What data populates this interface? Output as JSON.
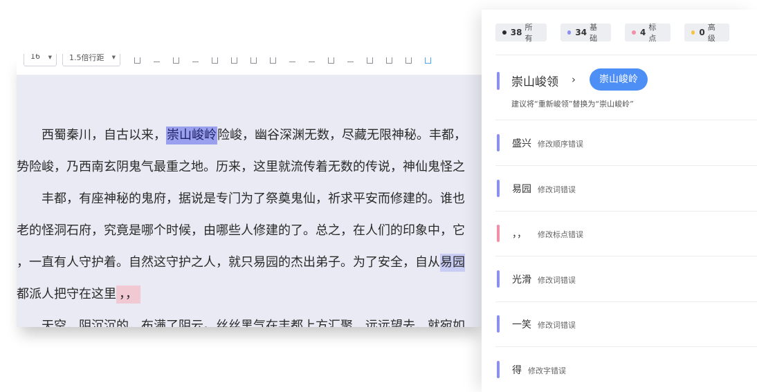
{
  "toolbar": {
    "font_size": "16",
    "line_spacing": "1.5倍行距"
  },
  "document": {
    "lines": [
      {
        "indent": true,
        "parts": [
          {
            "t": "西蜀秦川，自古以来，"
          },
          {
            "t": "崇山峻岭",
            "h": "blue"
          },
          {
            "t": "险峻，幽谷深渊无数，尽藏无限神秘。丰都，"
          }
        ]
      },
      {
        "indent": false,
        "parts": [
          {
            "t": "势险峻，乃西南玄阴鬼气最重之地。历来，这里就流传着无数的传说，神仙鬼怪之"
          }
        ]
      },
      {
        "indent": true,
        "parts": [
          {
            "t": "丰都，有座神秘的鬼府，据说是专门为了祭奠鬼仙，祈求平安而修建的。谁也"
          }
        ]
      },
      {
        "indent": false,
        "parts": [
          {
            "t": "老的怪洞石府，究竟是哪个时候，由哪些人修建的了。总之，在人们的印象中，它"
          }
        ]
      },
      {
        "indent": false,
        "parts": [
          {
            "t": "，一直有人守护着。自然这守护之人，就只易园的杰出弟子。为了安全，自从"
          },
          {
            "t": "易园",
            "h": "light"
          }
        ]
      },
      {
        "indent": false,
        "parts": [
          {
            "t": "都派人把守在这里"
          },
          {
            "t": "，，",
            "h": "pink"
          }
        ]
      },
      {
        "indent": true,
        "parts": [
          {
            "t": "天空，阴沉沉的，布满了阴云。丝丝黑气在丰都上方汇聚，远远望去，就宛如"
          }
        ]
      }
    ]
  },
  "panel": {
    "filters": [
      {
        "count": "38",
        "label": "所有",
        "color": "#2b2b2b"
      },
      {
        "count": "34",
        "label": "基础",
        "color": "#8b8ff0"
      },
      {
        "count": "4",
        "label": "标点",
        "color": "#f28fa6"
      },
      {
        "count": "0",
        "label": "高级",
        "color": "#f5c542"
      }
    ],
    "featured": {
      "original": "崇山峻领",
      "arrow": "›",
      "suggestion": "崇山峻岭",
      "hint": "建议将“重新峻领”替换为“崇山峻岭”"
    },
    "items": [
      {
        "word": "盛兴",
        "desc": "修改顺序错误",
        "color": "#8b8ff0"
      },
      {
        "word": "易园",
        "desc": "修改词错误",
        "color": "#8b8ff0"
      },
      {
        "word": "，，",
        "desc": "修改标点错误",
        "color": "#f28fa6"
      },
      {
        "word": "光滑",
        "desc": "修改词错误",
        "color": "#8b8ff0"
      },
      {
        "word": "一笑",
        "desc": "修改词错误",
        "color": "#8b8ff0"
      },
      {
        "word": "得",
        "desc": "修改字错误",
        "color": "#8b8ff0"
      }
    ]
  }
}
